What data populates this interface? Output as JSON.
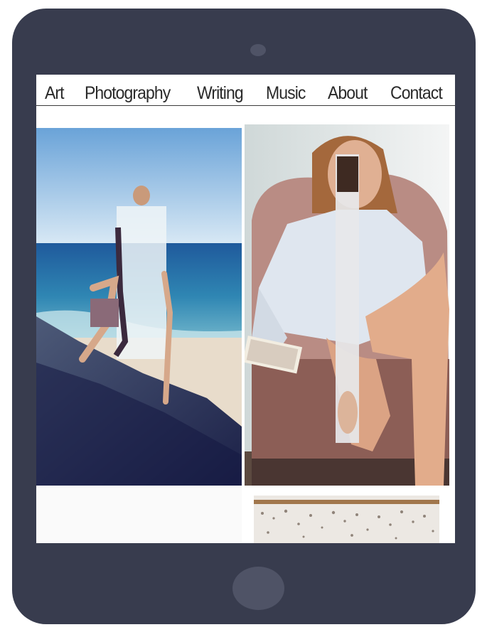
{
  "nav": {
    "items": [
      {
        "label": "Art"
      },
      {
        "label": "Photography"
      },
      {
        "label": "Writing"
      },
      {
        "label": "Music"
      },
      {
        "label": "About"
      },
      {
        "label": "Contact"
      }
    ]
  },
  "gallery": {
    "tiles": [
      {
        "subject": "woman-on-beach-rock-collage"
      },
      {
        "subject": "woman-in-armchair-collage"
      },
      {
        "subject": "blank-artwork"
      },
      {
        "subject": "textured-artwork"
      }
    ]
  },
  "colors": {
    "device": "#383c4e",
    "device_button": "#4f5366",
    "nav_text": "#2a2a2a"
  }
}
